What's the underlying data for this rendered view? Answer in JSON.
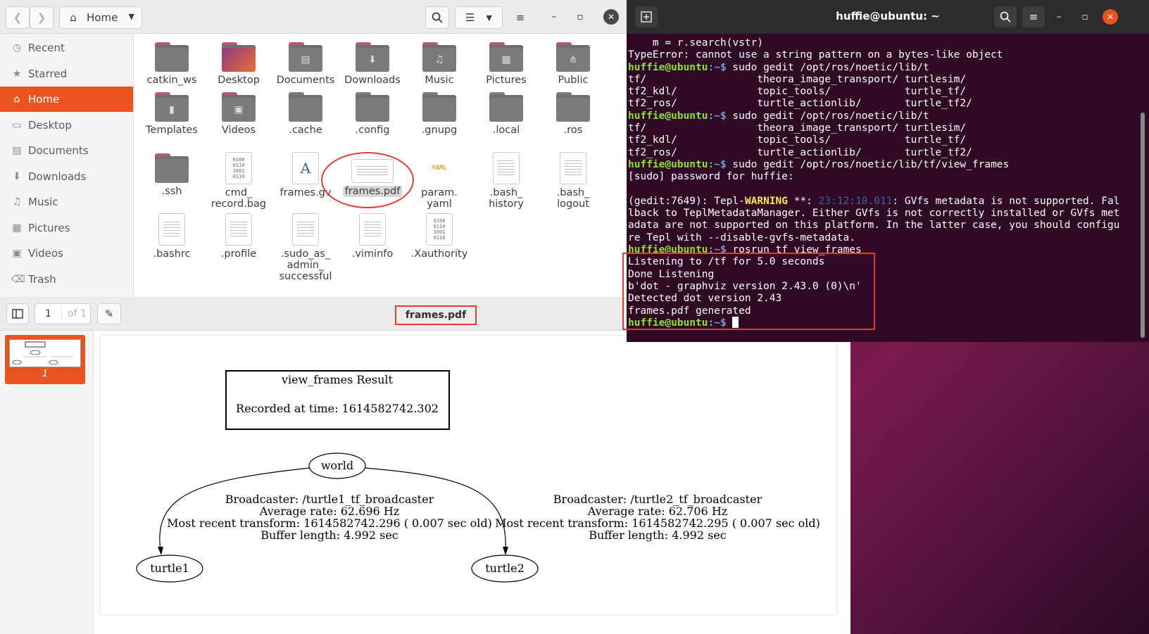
{
  "file_manager": {
    "location": "Home",
    "sidebar": [
      {
        "label": "Recent",
        "icon": "clock-icon"
      },
      {
        "label": "Starred",
        "icon": "star-icon"
      },
      {
        "label": "Home",
        "icon": "home-icon",
        "active": true
      },
      {
        "label": "Desktop",
        "icon": "desktop-icon"
      },
      {
        "label": "Documents",
        "icon": "documents-icon"
      },
      {
        "label": "Downloads",
        "icon": "download-icon"
      },
      {
        "label": "Music",
        "icon": "music-icon"
      },
      {
        "label": "Pictures",
        "icon": "pictures-icon"
      },
      {
        "label": "Videos",
        "icon": "videos-icon"
      },
      {
        "label": "Trash",
        "icon": "trash-icon"
      }
    ],
    "files": [
      {
        "label": "catkin_ws",
        "kind": "folder"
      },
      {
        "label": "Desktop",
        "kind": "folder"
      },
      {
        "label": "Documents",
        "kind": "folder"
      },
      {
        "label": "Downloads",
        "kind": "folder"
      },
      {
        "label": "Music",
        "kind": "folder"
      },
      {
        "label": "Pictures",
        "kind": "folder"
      },
      {
        "label": "Public",
        "kind": "folder"
      },
      {
        "label": "Templates",
        "kind": "folder"
      },
      {
        "label": "Videos",
        "kind": "folder"
      },
      {
        "label": ".cache",
        "kind": "folder"
      },
      {
        "label": ".config",
        "kind": "folder"
      },
      {
        "label": ".gnupg",
        "kind": "folder"
      },
      {
        "label": ".local",
        "kind": "folder"
      },
      {
        "label": ".ros",
        "kind": "folder"
      },
      {
        "label": ".ssh",
        "kind": "folder"
      },
      {
        "label": "cmd_\nrecord.bag",
        "kind": "binary"
      },
      {
        "label": "frames.gv",
        "kind": "text"
      },
      {
        "label": "frames.pdf",
        "kind": "pdf",
        "selected": true
      },
      {
        "label": "param.\nyaml",
        "kind": "yaml"
      },
      {
        "label": ".bash_\nhistory",
        "kind": "text"
      },
      {
        "label": ".bash_\nlogout",
        "kind": "text"
      },
      {
        "label": ".bashrc",
        "kind": "text"
      },
      {
        "label": ".profile",
        "kind": "text"
      },
      {
        "label": ".sudo_as_\nadmin_\nsuccessful",
        "kind": "text"
      },
      {
        "label": ".viminfo",
        "kind": "text"
      },
      {
        "label": ".Xauthority",
        "kind": "binary"
      }
    ]
  },
  "doc_viewer": {
    "page_current": "1",
    "page_total": "of 1",
    "title": "frames.pdf",
    "thumb_number": "1",
    "graph": {
      "result_title": "view_frames Result",
      "recorded": "Recorded at time: 1614582742.302",
      "root": "world",
      "child1": "turtle1",
      "child2": "turtle2",
      "edge1": [
        "Broadcaster: /turtle1_tf_broadcaster",
        "Average rate: 62.696 Hz",
        "Most recent transform: 1614582742.296 ( 0.007 sec old)",
        "Buffer length: 4.992 sec"
      ],
      "edge2": [
        "Broadcaster: /turtle2_tf_broadcaster",
        "Average rate: 62.706 Hz",
        "Most recent transform: 1614582742.295 ( 0.007 sec old)",
        "Buffer length: 4.992 sec"
      ]
    }
  },
  "terminal": {
    "title": "huffie@ubuntu: ~",
    "prompt_user": "huffie@ubuntu",
    "prompt_path": ":~$",
    "lines": [
      {
        "t": "plain",
        "text": "    m = r.search(vstr)"
      },
      {
        "t": "plain",
        "text": "TypeError: cannot use a string pattern on a bytes-like object"
      },
      {
        "t": "cmd",
        "text": " sudo gedit /opt/ros/noetic/lib/t"
      },
      {
        "t": "plain",
        "text": "tf/                  theora_image_transport/ turtlesim/"
      },
      {
        "t": "plain",
        "text": "tf2_kdl/             topic_tools/            turtle_tf/"
      },
      {
        "t": "plain",
        "text": "tf2_ros/             turtle_actionlib/       turtle_tf2/"
      },
      {
        "t": "cmd",
        "text": " sudo gedit /opt/ros/noetic/lib/t"
      },
      {
        "t": "plain",
        "text": "tf/                  theora_image_transport/ turtlesim/"
      },
      {
        "t": "plain",
        "text": "tf2_kdl/             topic_tools/            turtle_tf/"
      },
      {
        "t": "plain",
        "text": "tf2_ros/             turtle_actionlib/       turtle_tf2/"
      },
      {
        "t": "cmd",
        "text": " sudo gedit /opt/ros/noetic/lib/tf/view_frames"
      },
      {
        "t": "plain",
        "text": "[sudo] password for huffie:"
      },
      {
        "t": "plain",
        "text": ""
      },
      {
        "t": "warn",
        "pre": "(gedit:7649): Tepl-",
        "warn": "WARNING",
        "mid": " **: ",
        "ts": "23:12:10.011",
        "post": ": GVfs metadata is not supported. Fal"
      },
      {
        "t": "plain",
        "text": "lback to TeplMetadataManager. Either GVfs is not correctly installed or GVfs met"
      },
      {
        "t": "plain",
        "text": "adata are not supported on this platform. In the latter case, you should configu"
      },
      {
        "t": "plain",
        "text": "re Tepl with --disable-gvfs-metadata."
      },
      {
        "t": "cmd",
        "text": " rosrun tf view_frames"
      },
      {
        "t": "plain",
        "text": "Listening to /tf for 5.0 seconds"
      },
      {
        "t": "plain",
        "text": "Done Listening"
      },
      {
        "t": "plain",
        "text": "b'dot - graphviz version 2.43.0 (0)\\n'"
      },
      {
        "t": "plain",
        "text": "Detected dot version 2.43"
      },
      {
        "t": "plain",
        "text": "frames.pdf generated"
      },
      {
        "t": "cursor",
        "text": " "
      }
    ]
  },
  "colors": {
    "accent": "#e95420",
    "terminal_bg": "#300a24",
    "highlight": "#e53935"
  }
}
